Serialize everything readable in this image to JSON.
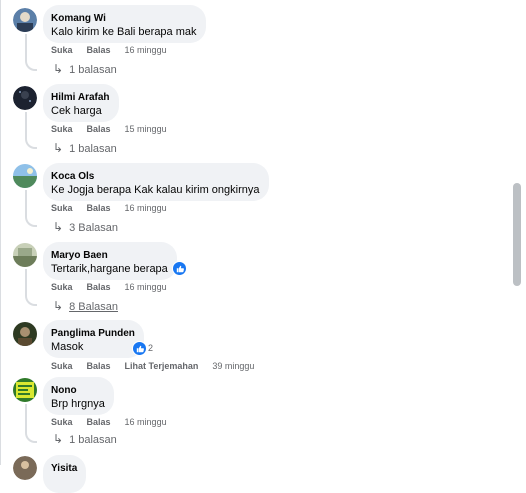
{
  "comments": [
    {
      "author": "Komang Wi",
      "text": "Kalo kirim ke Bali berapa mak",
      "like": "Suka",
      "reply": "Balas",
      "time": "16 minggu",
      "replies": "1 balasan",
      "avatar_color": "#5b7fa8"
    },
    {
      "author": "Hilmi Arafah",
      "text": "Cek harga",
      "like": "Suka",
      "reply": "Balas",
      "time": "15 minggu",
      "replies": "1 balasan",
      "avatar_color": "#1c2230"
    },
    {
      "author": "Koca Ols",
      "text": "Ke Jogja berapa Kak kalau kirim ongkirnya",
      "like": "Suka",
      "reply": "Balas",
      "time": "16 minggu",
      "replies": "3 Balasan",
      "avatar_color": "#4f8a5c"
    },
    {
      "author": "Maryo Baen",
      "text": "Tertarik,hargane berapa",
      "like": "Suka",
      "reply": "Balas",
      "time": "16 minggu",
      "replies": "8 Balasan",
      "avatar_color": "#6d7d5a"
    },
    {
      "author": "Panglima Punden",
      "text": "Masok",
      "like": "Suka",
      "reply": "Balas",
      "translate": "Lihat Terjemahan",
      "time": "39 minggu",
      "reaction_count": "2",
      "avatar_color": "#2e3a22"
    },
    {
      "author": "Nono",
      "text": "Brp hrgnya",
      "like": "Suka",
      "reply": "Balas",
      "time": "16 minggu",
      "replies": "1 balasan",
      "avatar_color": "#2f7a2a"
    },
    {
      "author": "Yisita",
      "avatar_color": "#7a6a58"
    }
  ]
}
